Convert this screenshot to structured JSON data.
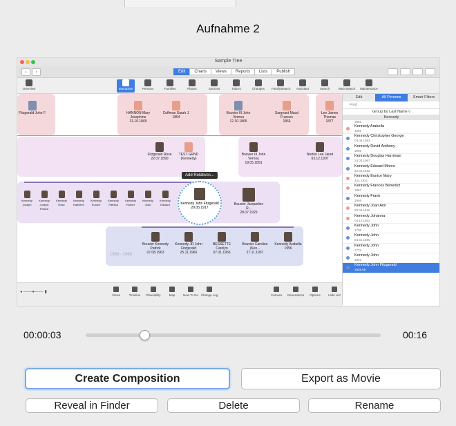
{
  "dialog": {
    "title": "Aufnahme 2",
    "time_current": "00:00:03",
    "time_total": "00:16",
    "playback_progress": 0.2,
    "buttons": {
      "create": "Create Composition",
      "export": "Export as Movie",
      "reveal": "Reveal in Finder",
      "delete": "Delete",
      "rename": "Rename"
    }
  },
  "preview": {
    "window_title": "Sample Tree",
    "segments": [
      "Edit",
      "Charts",
      "Views",
      "Reports",
      "Lists",
      "Publish"
    ],
    "active_segment": "Edit",
    "toolbar": [
      "Overview",
      "Interactive",
      "Persons",
      "Families",
      "Places",
      "Sources",
      "ToDo's",
      "Changes",
      "FamilySearch",
      "Assistant",
      "Search",
      "Web Search",
      "Maintenance"
    ],
    "context_menu": "Add Relatives...",
    "sidepanel": {
      "tabs": [
        "Edit",
        "All Persons",
        "Smart Filters"
      ],
      "active_tab": "All Persons",
      "find_placeholder": "Find",
      "group_by": "Group by Last Name ◊",
      "section": "Kennedy",
      "first_year": "1882",
      "rows": [
        {
          "name": "Kennedy Arabella",
          "year": "1956",
          "sex": "f"
        },
        {
          "name": "Kennedy Christopher George",
          "year": "04.06.1963",
          "sex": "m"
        },
        {
          "name": "Kennedy David Anthony",
          "year": "1955",
          "sex": "m"
        },
        {
          "name": "Kennedy Douglas Harriman",
          "year": "24.03.1967",
          "sex": "m"
        },
        {
          "name": "Kennedy Edward Moore",
          "year": "22.02.1932",
          "sex": "m"
        },
        {
          "name": "Kennedy Eunice Mary",
          "year": "JUL 1921",
          "sex": "f"
        },
        {
          "name": "Kennedy Frances Benedict",
          "year": "1887",
          "sex": "f"
        },
        {
          "name": "Kennedy Frank",
          "year": "1956",
          "sex": "m"
        },
        {
          "name": "Kennedy Joan Ann",
          "year": "20.02.1936",
          "sex": "f"
        },
        {
          "name": "Kennedy Johanna",
          "year": "04.12.1852",
          "sex": "f"
        },
        {
          "name": "Kennedy John",
          "year": "1798",
          "sex": "m"
        },
        {
          "name": "Kennedy John",
          "year": "04.01.1856",
          "sex": "m"
        },
        {
          "name": "Kennedy John",
          "year": "1776",
          "sex": "m"
        },
        {
          "name": "Kennedy John",
          "year": "1822",
          "sex": "m"
        },
        {
          "name": "Kennedy John Fitzgerald",
          "year": "1935.05",
          "sex": "m",
          "selected": true
        }
      ]
    },
    "tree": {
      "top_row": [
        {
          "name": "Fitzgerald John F.",
          "dates": ""
        },
        {
          "name": "HANNON Mary Josephine",
          "dates": "31.10.1865"
        },
        {
          "name": "Cuffman Sarah J.",
          "dates": "1854"
        },
        {
          "name": "Bouvier III John Vernou",
          "dates": "12.10.1865"
        },
        {
          "name": "Sargeant Maud Frances",
          "dates": "1866"
        },
        {
          "name": "Lee James Thomas",
          "dates": "1877"
        }
      ],
      "middle_row": [
        {
          "name": "Fitzgerald Rose",
          "dates": "22.07.1890"
        },
        {
          "name": "TEST GRND (Kennedy)",
          "dates": ""
        },
        {
          "name": "Bouvier III John Vernou",
          "dates": "19.05.1891"
        },
        {
          "name": "Norton Lee Janet",
          "dates": "03.12.1907"
        }
      ],
      "focus": {
        "name": "Kennedy John Fitzgerald",
        "dates": "29.05.1917"
      },
      "spouse": {
        "name": "Bouvier Jacqueline R...",
        "dates": "28.07.1929"
      },
      "children": [
        {
          "name": "Bouvier Kennedy Patrick",
          "dates": "07.08.1963"
        },
        {
          "name": "Kennedy JR John Fitzgerald",
          "dates": "25.11.1960"
        },
        {
          "name": "BESSETTE Carolyn",
          "dates": "07.01.1966"
        },
        {
          "name": "Bouvier Caroline (Ken...",
          "dates": "27.11.1957"
        },
        {
          "name": "Kennedy Arabella",
          "dates": "1956"
        }
      ],
      "year_range": "1956 - 1966",
      "siblings": [
        "Kennedy Joseph",
        "Kennedy Joseph Patrick",
        "Kennedy Rose",
        "Kennedy Kathleen",
        "Kennedy Eunice",
        "Kennedy Patricia",
        "Kennedy Robert",
        "Kennedy Jean",
        "Kennedy Edward"
      ]
    },
    "bottom_tools_left": [
      "Views",
      "Timeline",
      "Plausibility",
      "Map",
      "New To Do",
      "Change Log"
    ],
    "bottom_tools_right": [
      "Camera",
      "Generations",
      "Options",
      "Hide List"
    ]
  }
}
